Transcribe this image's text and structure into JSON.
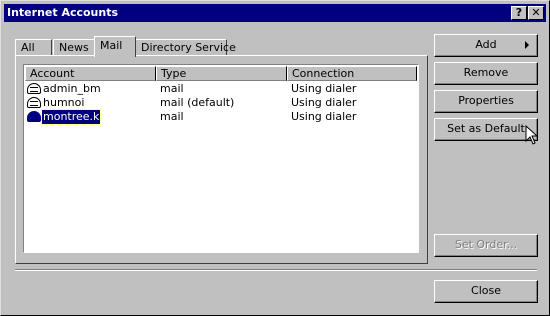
{
  "window": {
    "title": "Internet Accounts",
    "help_glyph": "?",
    "close_glyph": "✕"
  },
  "tabs": [
    {
      "label": "All",
      "active": false
    },
    {
      "label": "News",
      "active": false
    },
    {
      "label": "Mail",
      "active": true
    },
    {
      "label": "Directory Service",
      "active": false
    }
  ],
  "list": {
    "columns": [
      "Account",
      "Type",
      "Connection"
    ],
    "rows": [
      {
        "account": "admin_bm",
        "type": "mail",
        "connection": "Using dialer",
        "selected": false
      },
      {
        "account": "humnoi",
        "type": "mail (default)",
        "connection": "Using dialer",
        "selected": false
      },
      {
        "account": "montree.k",
        "type": "mail",
        "connection": "Using dialer",
        "selected": true
      }
    ]
  },
  "buttons": {
    "add": "Add",
    "remove": "Remove",
    "properties": "Properties",
    "set_default": "Set as Default",
    "set_order": "Set Order...",
    "close": "Close"
  },
  "icons": {
    "account": "mail-account-icon",
    "add_arrow": "right-arrow-icon",
    "cursor": "mouse-pointer-icon"
  },
  "colors": {
    "titlebar": "#000080",
    "selection": "#000080",
    "face": "#c0c0c0"
  }
}
